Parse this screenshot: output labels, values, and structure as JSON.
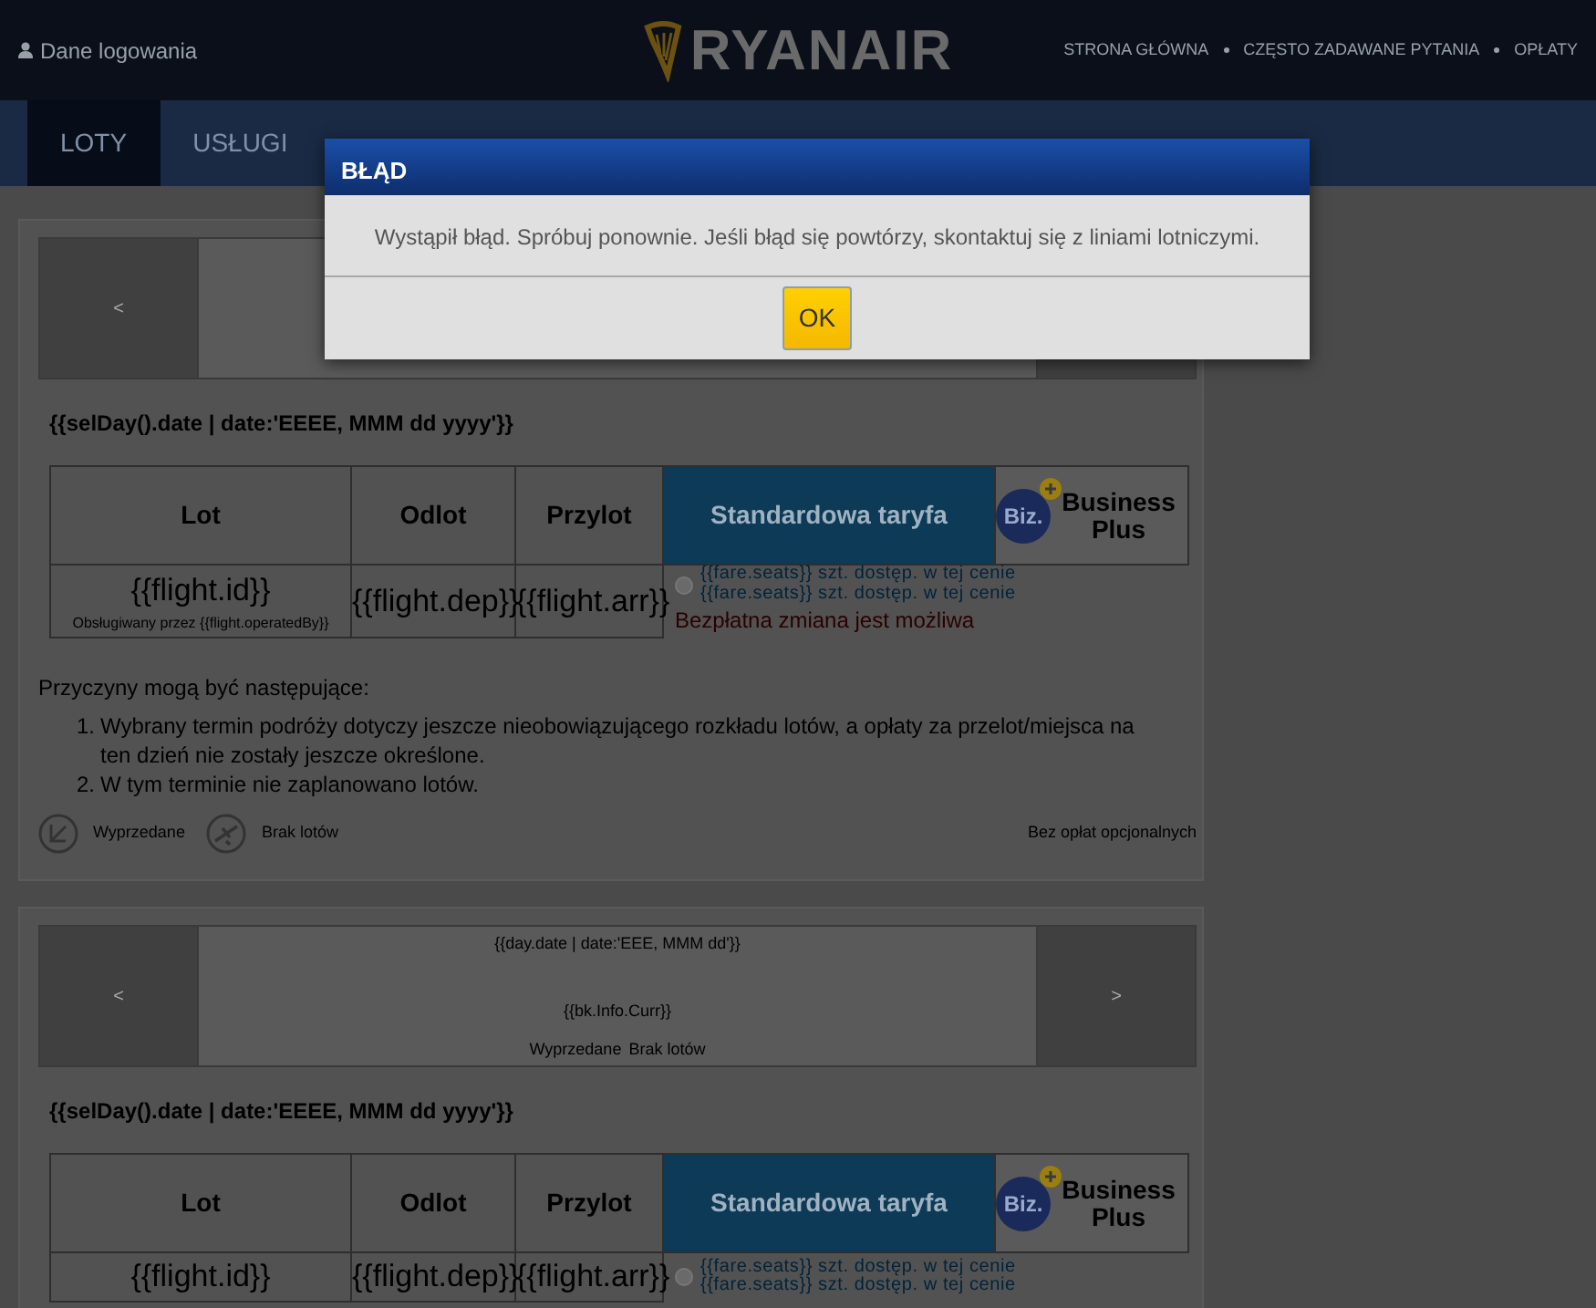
{
  "header": {
    "login_label": "Dane logowania",
    "logo_text": "RYANAIR",
    "links": [
      "STRONA GŁÓWNA",
      "CZĘSTO ZADAWANE PYTANIA",
      "OPŁATY"
    ]
  },
  "tabs": [
    {
      "label": "LOTY",
      "selected": true
    },
    {
      "label": "USŁUGI",
      "selected": false
    }
  ],
  "panels": [
    {
      "date_strip": {
        "prev": "<"
      },
      "date_heading": "{{selDay().date | date:'EEEE, MMM dd yyyy'}}",
      "table": {
        "columns": [
          "Lot",
          "Odlot",
          "Przylot",
          "Standardowa taryfa",
          "Business Plus"
        ],
        "badge_text": "Biz.",
        "row": {
          "flight_id": "{{flight.id}}",
          "operated_by": "Obsługiwany przez {{flight.operatedBy}}",
          "departure": "{{flight.dep}}",
          "arrival": "{{flight.arr}}",
          "fare_selected": false,
          "fare_lines": [
            "{{fare.seats}} szt. dostęp. w tej cenie",
            "{{fare.seats}} szt. dostęp. w tej cenie"
          ],
          "fare_note": "Bezpłatna zmiana jest możliwa"
        }
      },
      "reasons": {
        "intro": "Przyczyny mogą być następujące:",
        "items": [
          {
            "number": "1.",
            "text": "Wybrany termin podróży dotyczy jeszcze nieobowiązującego rozkładu lotów, a opłaty za przelot/miejsca na ten dzień nie zostały jeszcze określone."
          },
          {
            "number": "2.",
            "text": "W tym terminie nie zaplanowano lotów."
          }
        ]
      },
      "legend": {
        "items": [
          "Wyprzedane",
          "Brak lotów"
        ],
        "note": "Bez opłat opcjonalnych"
      }
    },
    {
      "date_strip": {
        "prev": "<",
        "next": ">",
        "center_texts": [
          "{{day.date | date:'EEE, MMM dd'}}",
          "{{bk.Info.Curr}}"
        ],
        "status_texts": [
          "Wyprzedane",
          "Brak lotów"
        ]
      },
      "date_heading": "{{selDay().date | date:'EEEE, MMM dd yyyy'}}",
      "table": {
        "columns": [
          "Lot",
          "Odlot",
          "Przylot",
          "Standardowa taryfa",
          "Business Plus"
        ],
        "badge_text": "Biz.",
        "row": {
          "flight_id": "{{flight.id}}",
          "departure": "{{flight.dep}}",
          "arrival": "{{flight.arr}}",
          "fare_selected": false,
          "fare_lines": [
            "{{fare.seats}} szt. dostęp. w tej cenie",
            "{{fare.seats}} szt. dostęp. w tej cenie"
          ]
        }
      }
    }
  ],
  "dialog": {
    "title": "BŁĄD",
    "message": "Wystąpił błąd. Spróbuj ponownie. Jeśli błąd się powtórzy, skontaktuj się z liniami lotniczymi.",
    "buttons": [
      "OK"
    ]
  }
}
